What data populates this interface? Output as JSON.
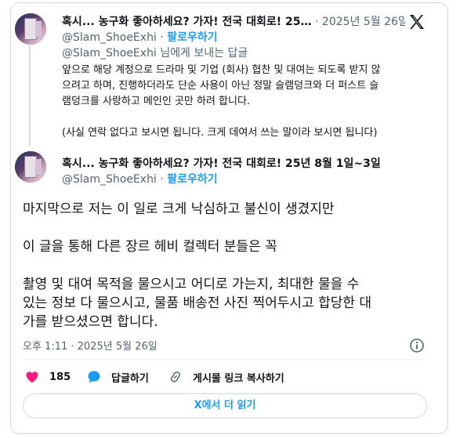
{
  "tweet1": {
    "display_name": "혹시... 농구화 좋아하세요? 가자! 전국 대회로! 25…",
    "date": "2025년 5월 26일",
    "handle": "@Slam_ShoeExhi",
    "separator": "·",
    "follow_label": "팔로우하기",
    "reply_to_handle": "@Slam_ShoeExhi",
    "reply_to_suffix": " 님에게 보내는 답글",
    "body_lines": [
      "앞으로 해당 계정으로 드라마 및 기업 (회사) 협찬 및 대여는 되도록 받지 않",
      "으려고 하며, 진행하더라도 단순 사용이 아닌 정말 슬램덩크와 더 퍼스트 슬",
      "램덩크를 사랑하고 메인인 곳만 하려 합니다.",
      "",
      "(사실 연락 없다고 보시면 됩니다. 크게 데여서 쓰는 말이라 보시면 됩니다)"
    ]
  },
  "tweet2": {
    "display_name": "혹시... 농구화 좋아하세요? 가자! 전국 대회로! 25년 8월 1일~3일",
    "handle": "@Slam_ShoeExhi",
    "separator": "·",
    "follow_label": "팔로우하기",
    "body_lines": [
      "마지막으로 저는 이 일로 크게 낙심하고 불신이 생겼지만",
      "",
      "이 글을 통해 다른 장르 헤비 컬렉터 분들은 꼭",
      "",
      "촬영 및 대여 목적을 물으시고 어디로 가는지, 최대한 물을 수",
      "있는 정보 다 물으시고, 물품 배송전 사진 찍어두시고 합당한 대",
      "가를 받으셨으면 합니다."
    ],
    "timestamp": "오후 1:11 · 2025년 5월 26일",
    "actions": {
      "like_count": "185",
      "reply_label": "답글하기",
      "copy_link_label": "게시물 링크 복사하기"
    },
    "read_more_label": "X에서 더 읽기"
  },
  "colors": {
    "accent": "#1d9bf0",
    "like": "#f91880",
    "muted": "#536471",
    "border": "#cfd9de"
  },
  "icons": [
    "x-logo-icon",
    "info-icon",
    "heart-icon",
    "reply-bubble-icon",
    "link-icon"
  ]
}
